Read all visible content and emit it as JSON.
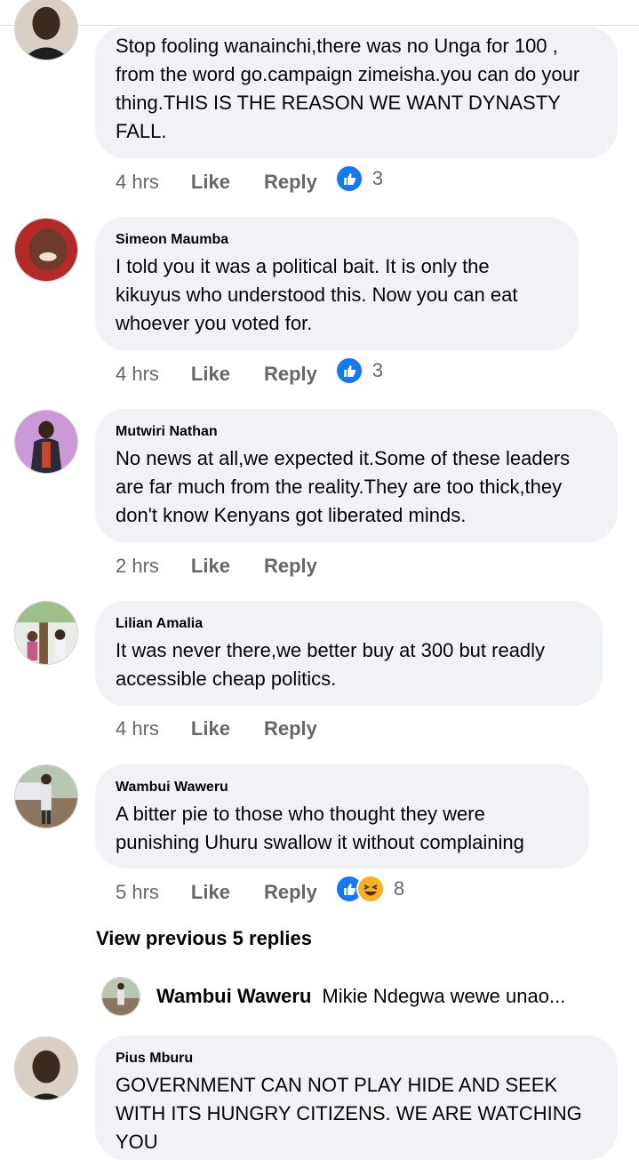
{
  "comments": [
    {
      "author": "",
      "text": "Stop fooling wanainchi,there was no Unga for 100 , from the word go.campaign zimeisha.you can do your thing.THIS IS THE  REASON WE WANT DYNASTY FALL.",
      "time": "4 hrs",
      "like": "Like",
      "reply": "Reply",
      "reactions": "3"
    },
    {
      "author": "Simeon Maumba",
      "text": "I told you it was a political bait. It is only the kikuyus who understood this. Now you can eat whoever you voted for.",
      "time": "4 hrs",
      "like": "Like",
      "reply": "Reply",
      "reactions": "3"
    },
    {
      "author": "Mutwiri Nathan",
      "text": "No news at all,we expected it.Some of these leaders are far much from the reality.They are too thick,they don't know Kenyans got liberated minds.",
      "time": "2 hrs",
      "like": "Like",
      "reply": "Reply",
      "reactions": ""
    },
    {
      "author": "Lilian Amalia",
      "text": "It was never there,we better buy at 300 but readly accessible cheap politics.",
      "time": "4 hrs",
      "like": "Like",
      "reply": "Reply",
      "reactions": ""
    },
    {
      "author": "Wambui Waweru",
      "text": "A bitter pie to those who thought they were punishing Uhuru swallow it without complaining",
      "time": "5 hrs",
      "like": "Like",
      "reply": "Reply",
      "reactions": "8"
    },
    {
      "author": "Pius Mburu",
      "text": "GOVERNMENT CAN NOT PLAY HIDE AND SEEK WITH ITS HUNGRY CITIZENS. WE ARE WATCHING YOU"
    }
  ],
  "view_previous": "View previous 5 replies",
  "reply_preview": {
    "name": "Wambui Waweru",
    "text": "Mikie Ndegwa wewe unao..."
  },
  "colors": {
    "like_blue": "#1877f2",
    "haha_yellow": "#f7b125",
    "bubble_bg": "#f0f2f5",
    "meta_gray": "#65676b"
  }
}
